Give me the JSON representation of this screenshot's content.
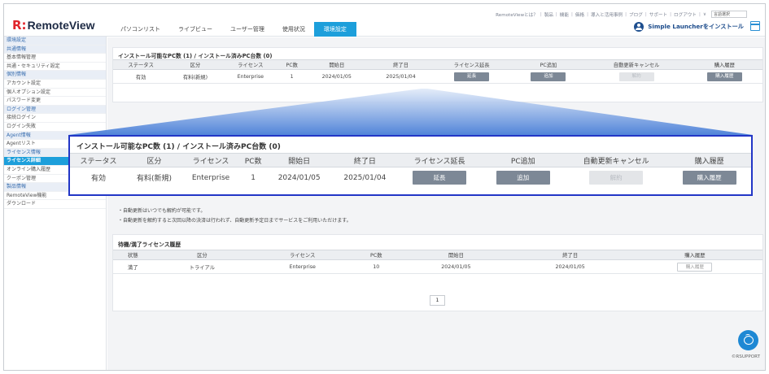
{
  "header": {
    "logo_mark": "R:",
    "logo_text": "RemoteView",
    "nav": [
      "パソコンリスト",
      "ライブビュー",
      "ユーザー管理",
      "使用状況",
      "環境設定"
    ],
    "top_links": [
      "RemoteViewとは？",
      "製品",
      "機能",
      "価格",
      "導入と活用事例",
      "ブログ",
      "サポート",
      "ログアウト"
    ],
    "language_select": "言語選択",
    "install_label": "Simple Launcherをインストール"
  },
  "sidebar": {
    "items": [
      {
        "label": "環境設定",
        "type": "section"
      },
      {
        "label": "共通情報",
        "type": "section"
      },
      {
        "label": "基本情報管理",
        "type": "sub"
      },
      {
        "label": "共通・セキュリティ設定",
        "type": "sub"
      },
      {
        "label": "個別情報",
        "type": "section"
      },
      {
        "label": "アカウント設定",
        "type": "sub"
      },
      {
        "label": "個人オプション設定",
        "type": "sub"
      },
      {
        "label": "パスワード変更",
        "type": "sub"
      },
      {
        "label": "ログイン管理",
        "type": "section"
      },
      {
        "label": "接続ログイン",
        "type": "sub"
      },
      {
        "label": "ログイン失敗",
        "type": "sub"
      },
      {
        "label": "Agent情報",
        "type": "section"
      },
      {
        "label": "Agentリスト",
        "type": "sub"
      },
      {
        "label": "ライセンス情報",
        "type": "section"
      },
      {
        "label": "ライセンス詳細",
        "type": "active"
      },
      {
        "label": "オンライン購入履歴",
        "type": "sub"
      },
      {
        "label": "クーポン管理",
        "type": "sub"
      },
      {
        "label": "製品情報",
        "type": "section"
      },
      {
        "label": "RemoteView機能",
        "type": "sub"
      },
      {
        "label": "ダウンロード",
        "type": "sub"
      }
    ]
  },
  "license_panel": {
    "title": "インストール可能なPC数 (1) / インストール済みPC台数 (0)",
    "columns": [
      "ステータス",
      "区分",
      "ライセンス",
      "PC数",
      "開始日",
      "終了日",
      "ライセンス延長",
      "PC追加",
      "自動更新キャンセル",
      "購入履歴"
    ],
    "row": {
      "status": "有効",
      "category": "有料(新規)",
      "license": "Enterprise",
      "pc_count": "1",
      "start": "2024/01/05",
      "end": "2025/01/04",
      "extend_btn": "延長",
      "add_btn": "追加",
      "cancel_btn": "解約",
      "history_btn": "購入履歴"
    }
  },
  "notes": [
    "・自動更新はいつでも解約が可能です。",
    "・自動更新を解約すると次回以降の決済は行われず、自動更新予定日までサービスをご利用いただけます。"
  ],
  "history_panel": {
    "title": "待機/満了ライセンス履歴",
    "columns": [
      "状態",
      "区分",
      "ライセンス",
      "PC数",
      "開始日",
      "終了日",
      "購入履歴"
    ],
    "row": {
      "status": "満了",
      "category": "トライアル",
      "license": "Enterprise",
      "pc_count": "10",
      "start": "2024/01/05",
      "end": "2024/01/05",
      "history_btn": "購入履歴"
    }
  },
  "pager": {
    "page": "1"
  },
  "footer": {
    "copyright": "©RSUPPORT"
  }
}
